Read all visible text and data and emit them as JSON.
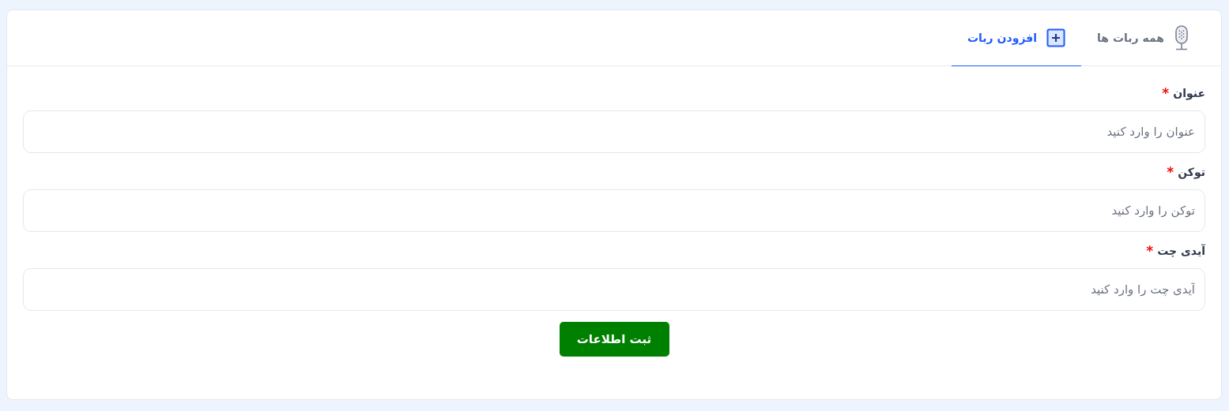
{
  "tabs": [
    {
      "label": "همه ربات ها",
      "kind": "microphone",
      "selected": false
    },
    {
      "label": "افزودن ربات",
      "kind": "add",
      "selected": true
    }
  ],
  "form": {
    "fields": [
      {
        "label": "عنوان",
        "required_mark": "*",
        "placeholder": "عنوان را وارد کنید"
      },
      {
        "label": "توکن",
        "required_mark": "*",
        "placeholder": "توکن را وارد کنید"
      },
      {
        "label": "آیدی چت",
        "required_mark": "*",
        "placeholder": "آیدی چت را وارد کنید"
      }
    ],
    "submit": "ثبت اطلاعات"
  }
}
